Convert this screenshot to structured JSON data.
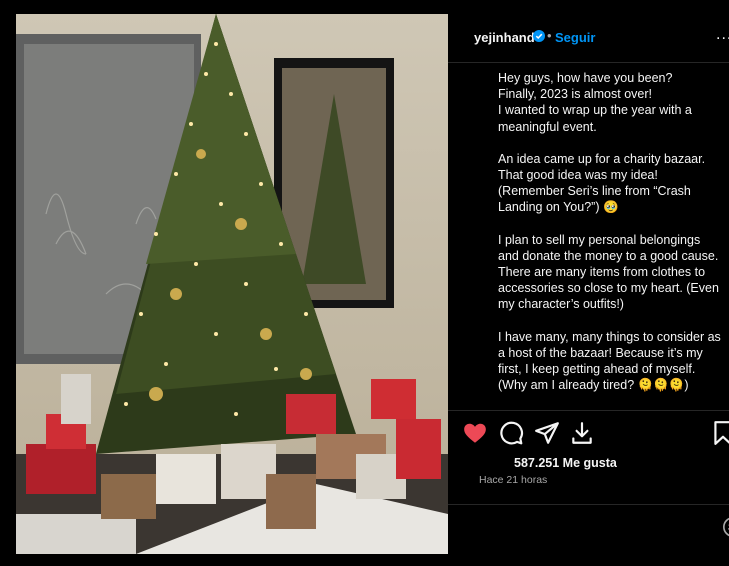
{
  "post": {
    "username": "yejinhand",
    "separator": "•",
    "follow_label": "Seguir",
    "more_label": "...",
    "caption_paragraphs": [
      "Hey guys, how have you been?\nFinally, 2023 is almost over!\nI wanted to wrap up the year with a meaningful event.",
      "An idea came up for a charity bazaar. That good idea was my idea!\n(Remember Seri’s line from “Crash Landing on You?”) 🥹",
      "I plan to sell my personal belongings and donate the money to a good cause. There are many items from clothes to accessories so close to my heart. (Even my character’s outfits!)",
      "I have many, many things to consider as a host of the bazaar! Because it’s my first, I keep getting ahead of myself. (Why am I already tired? 🫠🫠🫠)"
    ],
    "likes_text": "587.251 Me gusta",
    "time_text": "Hace 21 horas"
  },
  "icons": {
    "like": "heart-icon",
    "comment": "comment-icon",
    "share": "share-icon",
    "save_download": "download-icon",
    "bookmark": "bookmark-icon",
    "emoji": "emoji-icon",
    "verified": "verified-badge-icon"
  },
  "colors": {
    "like_red": "#ed4956",
    "follow_blue": "#0095f6",
    "verified_blue": "#0095f6",
    "background": "#000000"
  }
}
